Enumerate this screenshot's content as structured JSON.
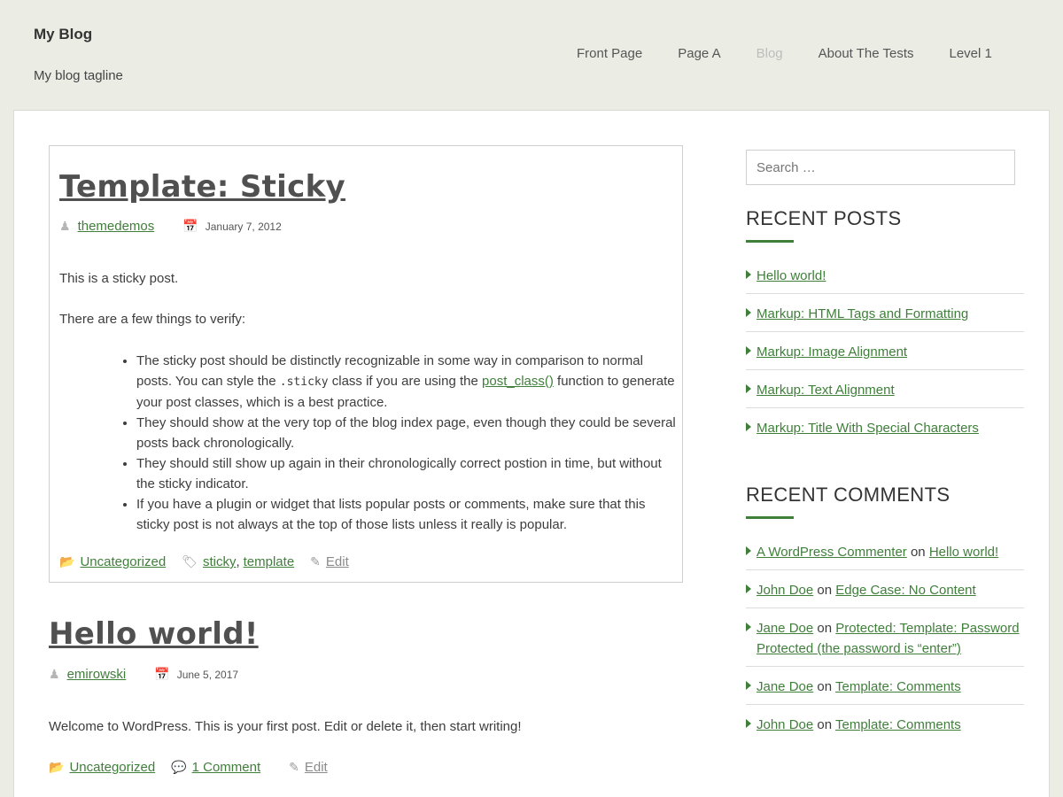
{
  "site": {
    "title": "My Blog",
    "tagline": "My blog tagline"
  },
  "nav": {
    "items": [
      {
        "label": "Front Page"
      },
      {
        "label": "Page A"
      },
      {
        "label": "Blog"
      },
      {
        "label": "About The Tests"
      },
      {
        "label": "Level 1"
      }
    ],
    "current": "Blog"
  },
  "sticky_post": {
    "title": "Template: Sticky",
    "author": "themedemos",
    "date": "January 7, 2012",
    "paragraph1": "This is a sticky post.",
    "paragraph2": "There are a few things to verify:",
    "bullets": {
      "b1_part1": "The sticky post should be distinctly recognizable in some way in comparison to normal posts. You can style the ",
      "b1_code": ".sticky",
      "b1_part2": " class if you are using the ",
      "b1_link": "post_class()",
      "b1_part3": " function to generate your post classes, which is a best practice.",
      "b2": "They should show at the very top of the blog index page, even though they could be several posts back chronologically.",
      "b3": "They should still show up again in their chronologically correct postion in time, but without the sticky indicator.",
      "b4": "If you have a plugin or widget that lists popular posts or comments, make sure that this sticky post is not always at the top of those lists unless it really is popular."
    },
    "category": "Uncategorized",
    "tags": [
      "sticky",
      "template"
    ],
    "tag_separator": ",",
    "edit_label": "Edit"
  },
  "hello_post": {
    "title": "Hello world!",
    "author": "emirowski",
    "date": "June 5, 2017",
    "paragraph": "Welcome to WordPress. This is your first post. Edit or delete it, then start writing!",
    "category": "Uncategorized",
    "comments_label": "1 Comment",
    "edit_label": "Edit"
  },
  "sidebar": {
    "search_placeholder": "Search …",
    "recent_posts_title": "RECENT POSTS",
    "recent_posts": [
      "Hello world!",
      "Markup: HTML Tags and Formatting",
      "Markup: Image Alignment",
      "Markup: Text Alignment",
      "Markup: Title With Special Characters"
    ],
    "recent_comments_title": "RECENT COMMENTS",
    "on_word": "on",
    "recent_comments": [
      {
        "author": "A WordPress Commenter",
        "post": "Hello world!"
      },
      {
        "author": "John Doe",
        "post": "Edge Case: No Content"
      },
      {
        "author": "Jane Doe",
        "post": "Protected: Template: Password Protected (the password is “enter”)"
      },
      {
        "author": "Jane Doe",
        "post": "Template: Comments"
      },
      {
        "author": "John Doe",
        "post": "Template: Comments"
      }
    ]
  },
  "colors": {
    "accent": "#3f7f3a",
    "header_bg": "#ebede5",
    "content_bg": "#ffffff"
  }
}
